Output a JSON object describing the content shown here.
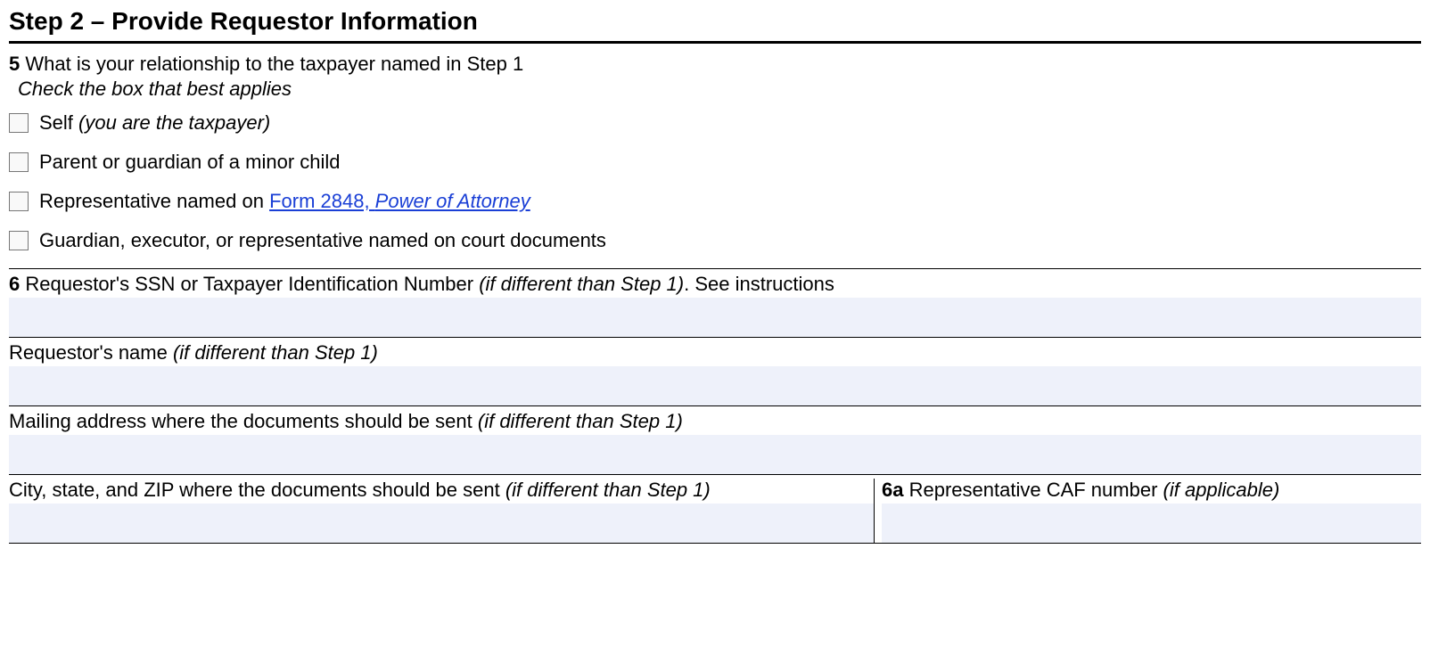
{
  "step": {
    "title": "Step 2 – Provide Requestor Information"
  },
  "q5": {
    "number": "5",
    "text": "What is your relationship to the taxpayer named in Step 1",
    "subtext": "Check the box that best applies",
    "options": {
      "self_prefix": "Self ",
      "self_italic": "(you are the taxpayer)",
      "parent": "Parent or guardian of a minor child",
      "rep_prefix": "Representative named on ",
      "rep_link_a": "Form 2848, ",
      "rep_link_b": "Power of Attorney",
      "guardian": "Guardian, executor, or representative named on court documents"
    }
  },
  "q6": {
    "number": "6",
    "ssn_label_a": "Requestor's SSN or Taxpayer Identification Number ",
    "ssn_label_b": "(if different than Step 1)",
    "ssn_label_c": ". See instructions",
    "name_label_a": "Requestor's name ",
    "name_label_b": "(if different than Step 1)",
    "mail_label_a": "Mailing address where the documents should be sent ",
    "mail_label_b": "(if different than Step 1)",
    "city_label_a": "City, state, and ZIP where the documents should be sent ",
    "city_label_b": "(if different than Step 1)"
  },
  "q6a": {
    "number": "6a",
    "label_a": "Representative CAF number ",
    "label_b": "(if applicable)"
  }
}
